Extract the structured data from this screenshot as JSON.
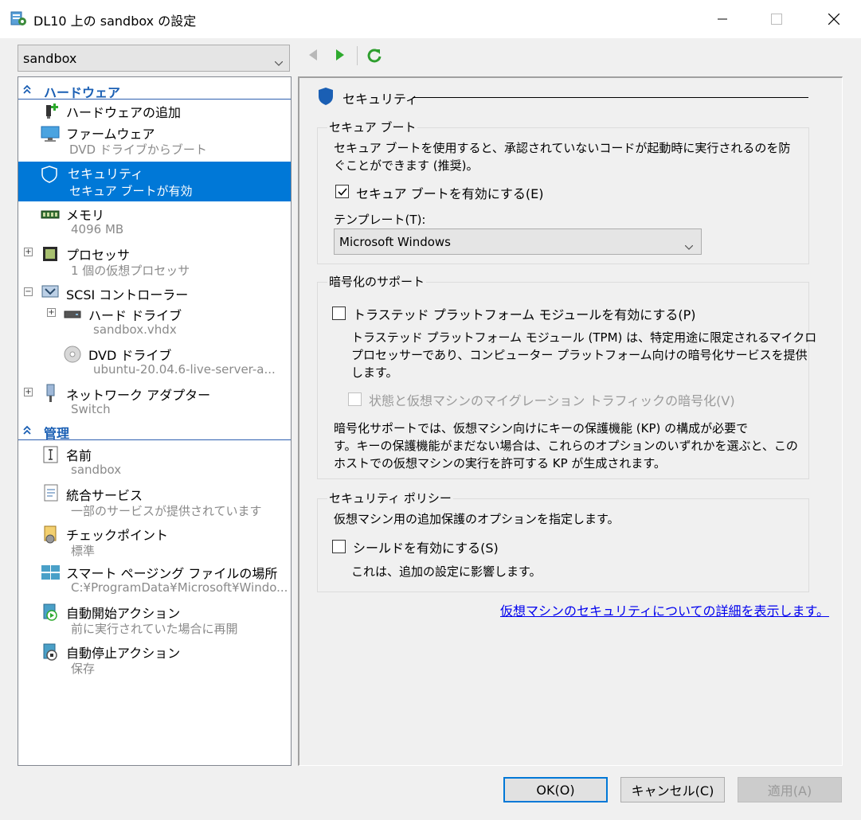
{
  "window": {
    "title": "DL10 上の sandbox の設定"
  },
  "vm_selector": {
    "value": "sandbox"
  },
  "left_panel": {
    "hardware_header": "ハードウェア",
    "management_header": "管理",
    "items": [
      {
        "name": "ハードウェアの追加",
        "sub": ""
      },
      {
        "name": "ファームウェア",
        "sub": "DVD ドライブからブート"
      },
      {
        "name": "セキュリティ",
        "sub": "セキュア ブートが有効"
      },
      {
        "name": "メモリ",
        "sub": "4096 MB"
      },
      {
        "name": "プロセッサ",
        "sub": "1 個の仮想プロセッサ"
      },
      {
        "name": "SCSI コントローラー",
        "sub": ""
      },
      {
        "name": "ハード ドライブ",
        "sub": "sandbox.vhdx"
      },
      {
        "name": "DVD ドライブ",
        "sub": "ubuntu-20.04.6-live-server-a..."
      },
      {
        "name": "ネットワーク アダプター",
        "sub": "Switch"
      },
      {
        "name": "名前",
        "sub": "sandbox"
      },
      {
        "name": "統合サービス",
        "sub": "一部のサービスが提供されています"
      },
      {
        "name": "チェックポイント",
        "sub": "標準"
      },
      {
        "name": "スマート ページング ファイルの場所",
        "sub": "C:¥ProgramData¥Microsoft¥Windo..."
      },
      {
        "name": "自動開始アクション",
        "sub": "前に実行されていた場合に再開"
      },
      {
        "name": "自動停止アクション",
        "sub": "保存"
      }
    ]
  },
  "right_panel": {
    "heading": "セキュリティ",
    "secure_boot": {
      "group_title": "セキュア ブート",
      "desc_line1": "セキュア ブートを使用すると、承認されていないコードが起動時に実行されるのを防",
      "desc_line2": "ぐことができます (推奨)。",
      "enable_label": "セキュア ブートを有効にする(E)",
      "enable_checked": true,
      "template_label": "テンプレート(T):",
      "template_value": "Microsoft Windows"
    },
    "encryption": {
      "group_title": "暗号化のサポート",
      "tpm_label": "トラステッド プラットフォーム モジュールを有効にする(P)",
      "tpm_checked": false,
      "tpm_desc_line1": "トラステッド プラットフォーム モジュール (TPM) は、特定用途に限定されるマイクロ",
      "tpm_desc_line2": "プロセッサーであり、コンピューター プラットフォーム向けの暗号化サービスを提供",
      "tpm_desc_line3": "します。",
      "migration_label": "状態と仮想マシンのマイグレーション トラフィックの暗号化(V)",
      "migration_checked": false,
      "kp_line1": "暗号化サポートでは、仮想マシン向けにキーの保護機能 (KP) の構成が必要で",
      "kp_line2": "す。キーの保護機能がまだない場合は、これらのオプションのいずれかを選ぶと、この",
      "kp_line3": "ホストでの仮想マシンの実行を許可する KP が生成されます。"
    },
    "policy": {
      "group_title": "セキュリティ ポリシー",
      "desc": "仮想マシン用の追加保護のオプションを指定します。",
      "shield_label": "シールドを有効にする(S)",
      "shield_checked": false,
      "shield_desc": "これは、追加の設定に影響します。"
    },
    "link": "仮想マシンのセキュリティについての詳細を表示します。"
  },
  "buttons": {
    "ok": "OK(O)",
    "cancel": "キャンセル(C)",
    "apply": "適用(A)"
  },
  "colors": {
    "selection": "#0078d7",
    "section_header": "#1a5fb4",
    "link": "#0000ee"
  }
}
